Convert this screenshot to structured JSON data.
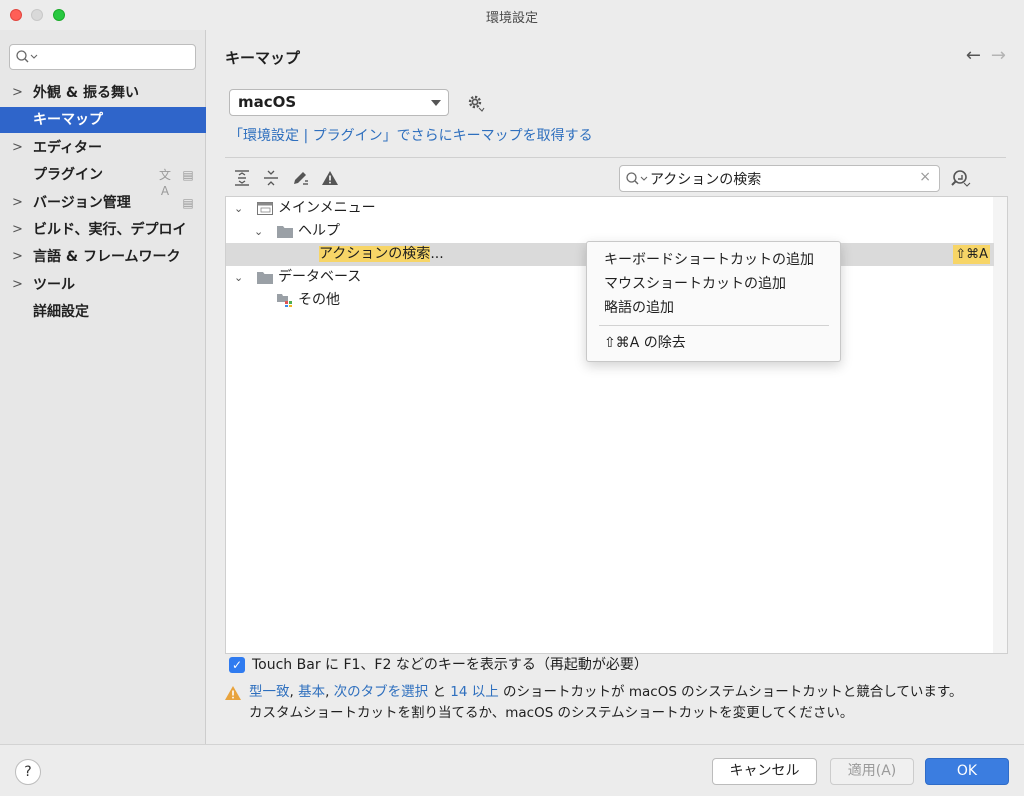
{
  "window": {
    "title": "環境設定"
  },
  "sidebar": {
    "search_placeholder": "",
    "items": [
      {
        "label": "外観 & 振る舞い",
        "expandable": true
      },
      {
        "label": "キーマップ",
        "expandable": false,
        "selected": true
      },
      {
        "label": "エディター",
        "expandable": true
      },
      {
        "label": "プラグイン",
        "expandable": false
      },
      {
        "label": "バージョン管理",
        "expandable": true
      },
      {
        "label": "ビルド、実行、デプロイ",
        "expandable": true
      },
      {
        "label": "言語 & フレームワーク",
        "expandable": true
      },
      {
        "label": "ツール",
        "expandable": true
      },
      {
        "label": "詳細設定",
        "expandable": false
      }
    ]
  },
  "main": {
    "heading": "キーマップ",
    "keymap_select": "macOS",
    "get_more_link": "「環境設定 | プラグイン」でさらにキーマップを取得する",
    "action_search_value": "アクションの検索",
    "tree": {
      "main_menu": "メインメニュー",
      "help": "ヘルプ",
      "find_action": "アクションの検索",
      "find_action_suffix": "...",
      "find_action_shortcut": "⇧⌘A",
      "database": "データベース",
      "other": "その他"
    },
    "touch_bar_label": "Touch Bar に F1、F2 などのキーを表示する（再起動が必要）",
    "conflict": {
      "link1": "型一致",
      "sep1": ", ",
      "link2": "基本",
      "sep2": ", ",
      "link3": "次のタブを選択",
      "mid": " と ",
      "link4": "14 以上",
      "tail": " のショートカットが macOS のシステムショートカットと競合しています。",
      "line2": "カスタムショートカットを割り当てるか、macOS のシステムショートカットを変更してください。"
    }
  },
  "context_menu": {
    "items": [
      "キーボードショートカットの追加",
      "マウスショートカットの追加",
      "略語の追加"
    ],
    "remove": "⇧⌘A の除去"
  },
  "footer": {
    "help": "?",
    "cancel": "キャンセル",
    "apply": "適用(A)",
    "ok": "OK"
  },
  "colors": {
    "selection": "#2f65ca",
    "link": "#2e6fbe",
    "highlight": "#f7d567",
    "ok_button": "#3b7de0"
  }
}
